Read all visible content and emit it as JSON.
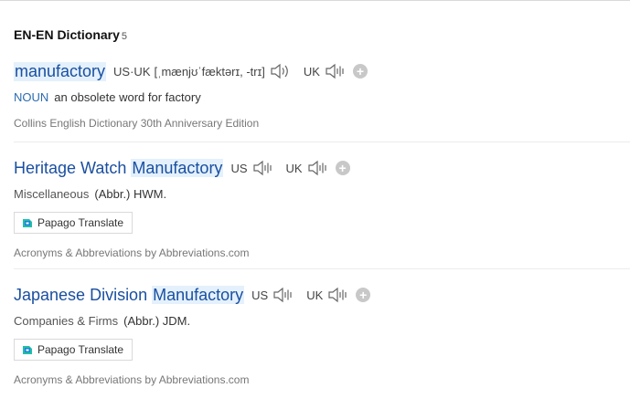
{
  "section": {
    "title": "EN-EN Dictionary",
    "count": "5"
  },
  "entries": [
    {
      "word": "manufactory",
      "pron": {
        "label": "US·UK",
        "ipa": "[ˌmænjʊˈfæktərɪ, -trɪ]",
        "uk_label": "UK"
      },
      "pos": "NOUN",
      "definition": "an obsolete word for factory",
      "source": "Collins English Dictionary 30th Anniversary Edition"
    },
    {
      "word_prefix": "Heritage Watch ",
      "word_highlight": "Manufactory",
      "us_label": "US",
      "uk_label": "UK",
      "category": "Miscellaneous",
      "definition": "(Abbr.) HWM.",
      "button": "Papago Translate",
      "source": "Acronyms & Abbreviations by Abbreviations.com"
    },
    {
      "word_prefix": "Japanese Division ",
      "word_highlight": "Manufactory",
      "us_label": "US",
      "uk_label": "UK",
      "category": "Companies & Firms",
      "definition": "(Abbr.) JDM.",
      "button": "Papago Translate",
      "source": "Acronyms & Abbreviations by Abbreviations.com"
    }
  ],
  "icons": {
    "speaker": "speaker-icon",
    "add": "add-icon",
    "papago": "papago-logo-icon"
  },
  "colors": {
    "link": "#1a4fa0",
    "highlight": "#e4f1fc",
    "pos": "#2b6cb0"
  }
}
